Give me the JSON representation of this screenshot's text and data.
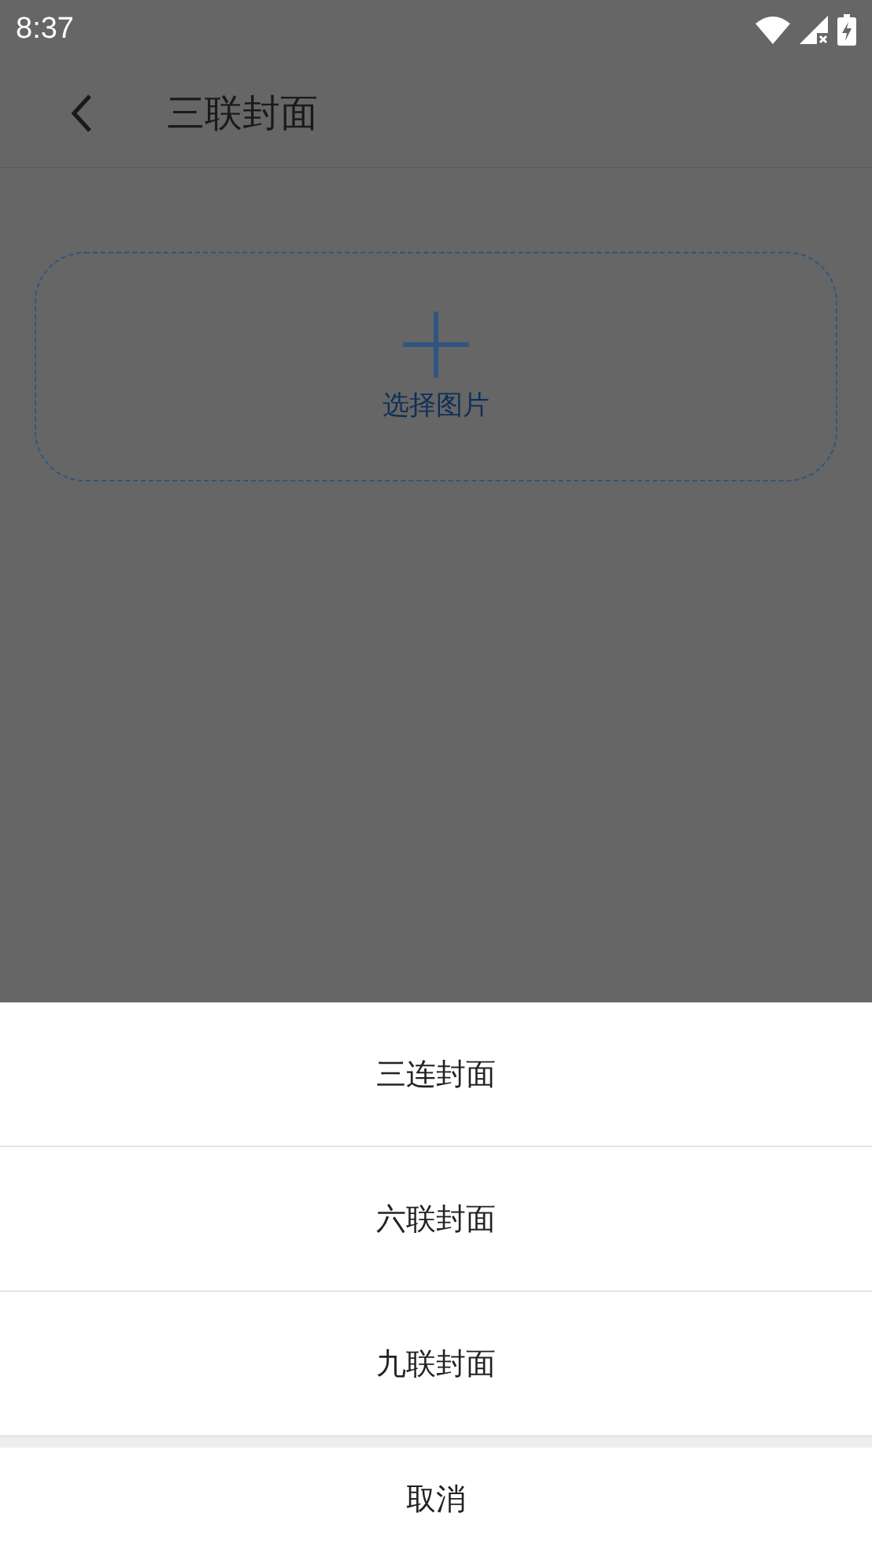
{
  "status_bar": {
    "time": "8:37"
  },
  "app_bar": {
    "title": "三联封面"
  },
  "picker": {
    "label": "选择图片"
  },
  "sheet": {
    "options": [
      "三连封面",
      "六联封面",
      "九联封面"
    ],
    "cancel": "取消"
  }
}
